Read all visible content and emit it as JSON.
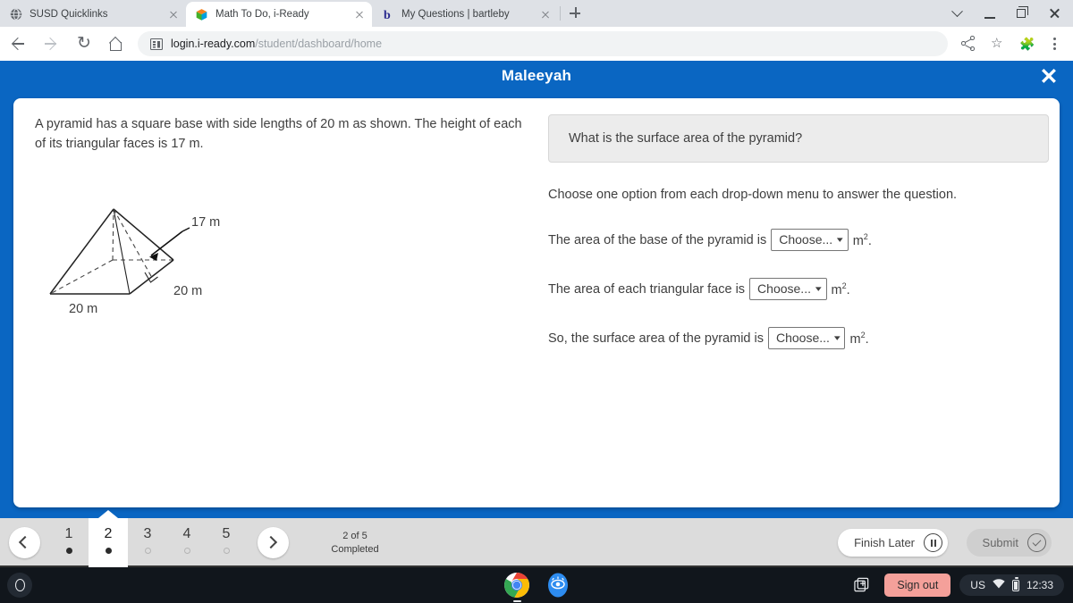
{
  "browser": {
    "tabs": [
      {
        "title": "SUSD Quicklinks",
        "favicon": "globe-icon",
        "active": false
      },
      {
        "title": "Math To Do, i-Ready",
        "favicon": "iready-cube-icon",
        "active": true
      },
      {
        "title": "My Questions | bartleby",
        "favicon": "bartleby-b-icon",
        "active": false
      }
    ],
    "new_tab_label": "+",
    "window_controls": [
      "chevron-down-icon",
      "minimize-icon",
      "maximize-icon",
      "close-icon"
    ],
    "nav": {
      "back": "back-arrow-icon",
      "forward": "forward-arrow-icon",
      "reload": "reload-icon",
      "home": "home-icon"
    },
    "omnibox": {
      "icon": "site-info-icon",
      "url_host": "login.i-ready.com",
      "url_path": "/student/dashboard/home"
    },
    "toolbar_right": [
      "share-icon",
      "bookmark-star-icon",
      "extensions-puzzle-icon",
      "chrome-menu-icon"
    ]
  },
  "app": {
    "header": {
      "student_name": "Maleeyah",
      "close_label": "✕",
      "accent_color": "#0a66c2"
    },
    "left_panel": {
      "prompt": "A pyramid has a square base with side lengths of 20 m as shown. The height of each of its triangular faces is 17 m.",
      "figure": {
        "name": "square-pyramid-diagram",
        "labels": {
          "slant_height": "17 m",
          "base_side_right": "20 m",
          "base_side_front": "20 m"
        }
      }
    },
    "right_panel": {
      "question": "What is the surface area of the pyramid?",
      "instruction": "Choose one option from each drop-down menu to answer the question.",
      "blanks": [
        {
          "lead": "The area of the base of the pyramid is",
          "selected": "Choose...",
          "unit": "m",
          "unit_exp": "2",
          "trail": "."
        },
        {
          "lead": "The area of each triangular face is",
          "selected": "Choose...",
          "unit": "m",
          "unit_exp": "2",
          "trail": "."
        },
        {
          "lead": "So, the surface area of the pyramid is",
          "selected": "Choose...",
          "unit": "m",
          "unit_exp": "2",
          "trail": "."
        }
      ]
    },
    "footer": {
      "prev_label": "‹",
      "next_label": "›",
      "pages": [
        {
          "number": "1",
          "state": "answered",
          "active": false
        },
        {
          "number": "2",
          "state": "answered",
          "active": true
        },
        {
          "number": "3",
          "state": "unanswered",
          "active": false
        },
        {
          "number": "4",
          "state": "unanswered",
          "active": false
        },
        {
          "number": "5",
          "state": "unanswered",
          "active": false
        }
      ],
      "progress_line1": "2 of 5",
      "progress_line2": "Completed",
      "finish_later_label": "Finish Later",
      "submit_label": "Submit"
    }
  },
  "shelf": {
    "launcher": "launcher-icon",
    "apps": [
      {
        "name": "chrome-icon"
      },
      {
        "name": "securly-eye-icon"
      }
    ],
    "tray": {
      "screen_capture_icon": "screen-capture-icon",
      "sign_out_label": "Sign out",
      "sign_out_color": "#f4a09a",
      "keyboard_layout": "US",
      "wifi_icon": "wifi-icon",
      "battery_icon": "battery-icon",
      "clock": "12:33"
    }
  }
}
